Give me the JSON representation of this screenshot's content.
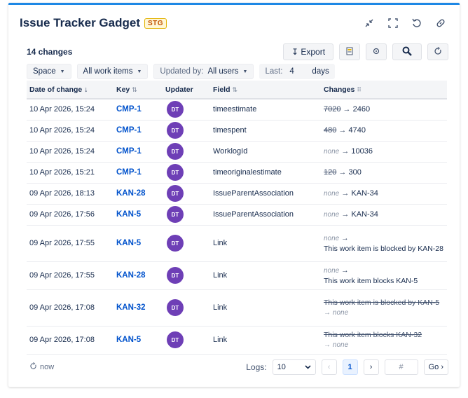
{
  "gadget": {
    "title": "Issue Tracker Gadget",
    "badge": "STG",
    "header_icons": [
      "collapse-icon",
      "fullscreen-icon",
      "undo-icon",
      "link-icon"
    ]
  },
  "toolbar": {
    "count": "14 changes",
    "export_label": "↧ Export",
    "icons": [
      "document-icon",
      "settings-icon",
      "search-icon",
      "refresh-icon"
    ]
  },
  "filters": {
    "space": "Space",
    "work_items": "All work items",
    "updated_by_label": "Updated by:",
    "updated_by_value": "All users",
    "last_label": "Last:",
    "last_value": "4",
    "days_label": "days"
  },
  "table": {
    "headers": {
      "date": "Date of change ↓",
      "key": "Key",
      "key_sort": "⇅",
      "updater": "Updater",
      "field": "Field",
      "field_sort": "⇅",
      "changes": "Changes",
      "changes_icon": "⠿"
    },
    "rows": [
      {
        "date": "10 Apr 2026, 15:24",
        "key": "CMP-1",
        "updater": "DT",
        "field": "timeestimate",
        "old": "7020",
        "arrow": "→",
        "new": "2460"
      },
      {
        "date": "10 Apr 2026, 15:24",
        "key": "CMP-1",
        "updater": "DT",
        "field": "timespent",
        "old": "480",
        "arrow": "→",
        "new": "4740"
      },
      {
        "date": "10 Apr 2026, 15:24",
        "key": "CMP-1",
        "updater": "DT",
        "field": "WorklogId",
        "none": "none",
        "arrow": "→",
        "new": "10036"
      },
      {
        "date": "10 Apr 2026, 15:21",
        "key": "CMP-1",
        "updater": "DT",
        "field": "timeoriginalestimate",
        "old": "120",
        "arrow": "→",
        "new": "300"
      },
      {
        "date": "09 Apr 2026, 18:13",
        "key": "KAN-28",
        "updater": "DT",
        "field": "IssueParentAssociation",
        "none": "none",
        "arrow": "→",
        "new": "KAN-34"
      },
      {
        "date": "09 Apr 2026, 17:56",
        "key": "KAN-5",
        "updater": "DT",
        "field": "IssueParentAssociation",
        "none": "none",
        "arrow": "→",
        "new": "KAN-34"
      },
      {
        "date": "09 Apr 2026, 17:55",
        "key": "KAN-5",
        "updater": "DT",
        "field": "Link",
        "none": "none",
        "arrow": "→",
        "new": "This work item is blocked by KAN-28"
      },
      {
        "date": "09 Apr 2026, 17:55",
        "key": "KAN-28",
        "updater": "DT",
        "field": "Link",
        "none": "none",
        "arrow": "→",
        "new": "This work item blocks KAN-5"
      },
      {
        "date": "09 Apr 2026, 17:08",
        "key": "KAN-32",
        "updater": "DT",
        "field": "Link",
        "old": "This work item is blocked by KAN-5",
        "arrow": "→",
        "none": "none"
      },
      {
        "date": "09 Apr 2026, 17:08",
        "key": "KAN-5",
        "updater": "DT",
        "field": "Link",
        "old": "This work item blocks KAN-32",
        "arrow": "→",
        "none": "none"
      }
    ]
  },
  "footer": {
    "refresh_label": "now",
    "logs_label": "Logs:",
    "logs_value": "10",
    "prev": "‹",
    "page": "1",
    "next": "›",
    "page_input_placeholder": "#",
    "go_label": "Go ›"
  },
  "colors": {
    "accent": "#1e88e5",
    "key_link": "#0052cc",
    "avatar": "#6e3fb6"
  }
}
